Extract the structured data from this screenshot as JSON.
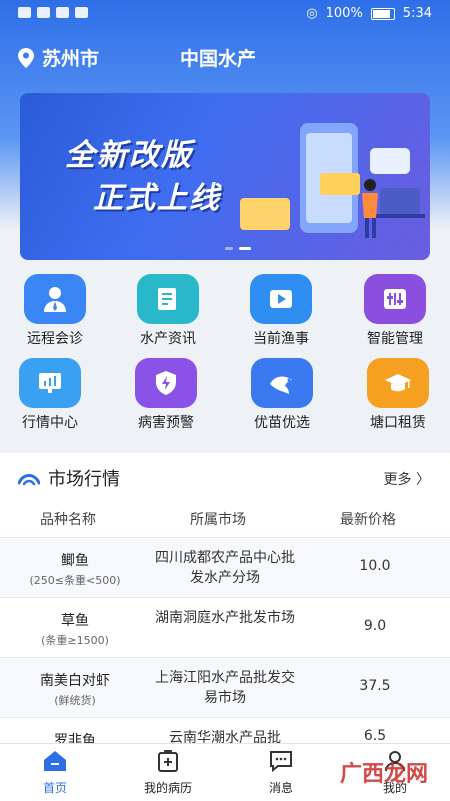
{
  "status_bar": {
    "battery": "100%",
    "time": "5:34"
  },
  "header": {
    "city": "苏州市",
    "title": "中国水产"
  },
  "banner": {
    "line1": "全新改版",
    "line2": "正式上线"
  },
  "quick_menu": [
    {
      "label": "远程会诊",
      "icon": "doctor-consult-icon",
      "color": "#3a86f5"
    },
    {
      "label": "水产资讯",
      "icon": "news-icon",
      "color": "#28b8c9"
    },
    {
      "label": "当前渔事",
      "icon": "video-play-icon",
      "color": "#2f8ef2"
    },
    {
      "label": "智能管理",
      "icon": "control-panel-icon",
      "color": "#8b4fe0"
    },
    {
      "label": "行情中心",
      "icon": "market-chart-icon",
      "color": "#3aa0f2"
    },
    {
      "label": "病害预警",
      "icon": "shield-alert-icon",
      "color": "#8a52e6"
    },
    {
      "label": "优苗优选",
      "icon": "fish-icon",
      "color": "#3a79ef"
    },
    {
      "label": "塘口租赁",
      "icon": "graduation-cap-icon",
      "color": "#f5a020"
    }
  ],
  "market": {
    "title": "市场行情",
    "more": "更多",
    "headers": [
      "品种名称",
      "所属市场",
      "最新价格"
    ],
    "rows": [
      {
        "name": "鲫鱼",
        "sub": "(250≤条重<500)",
        "market": "四川成都农产品中心批发水产分场",
        "price": "10.0"
      },
      {
        "name": "草鱼",
        "sub": "(条重≥1500)",
        "market": "湖南洞庭水产批发市场",
        "price": "9.0"
      },
      {
        "name": "南美白对虾",
        "sub": "(鲜统货)",
        "market": "上海江阳水产品批发交易市场",
        "price": "37.5"
      },
      {
        "name": "罗非鱼",
        "sub": "",
        "market": "云南华潮水产品批",
        "price": "6.5"
      }
    ]
  },
  "tabs": [
    {
      "label": "首页",
      "icon": "home-icon"
    },
    {
      "label": "我的病历",
      "icon": "medical-record-icon"
    },
    {
      "label": "消息",
      "icon": "message-icon"
    },
    {
      "label": "我的",
      "icon": "user-icon"
    }
  ],
  "watermark": "广西龙网"
}
